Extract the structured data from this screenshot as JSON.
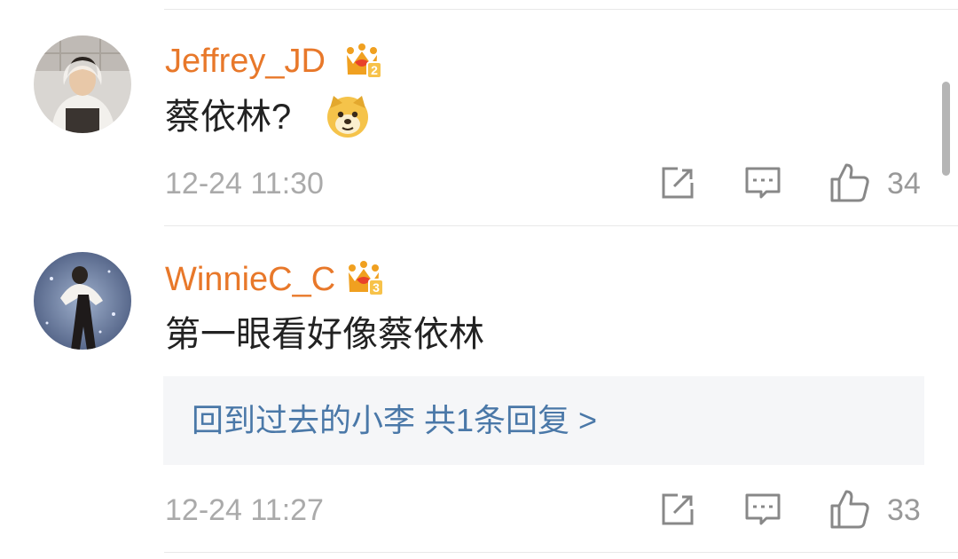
{
  "comments": [
    {
      "username": "Jeffrey_JD",
      "badge_level": "2",
      "text": "蔡依林?",
      "emoji": "doge-emoji",
      "timestamp": "12-24 11:30",
      "likes": "34"
    },
    {
      "username": "WinnieC_C",
      "badge_level": "3",
      "text": "第一眼看好像蔡依林",
      "reply_summary": "回到过去的小李  共1条回复 >",
      "timestamp": "12-24 11:27",
      "likes": "33"
    }
  ],
  "icons": {
    "repost": "repost-icon",
    "comment": "comment-icon",
    "like": "thumbs-up-icon",
    "badge": "crown-badge-icon"
  },
  "colors": {
    "username": "#e8782a",
    "reply_link": "#4a78a8",
    "meta_text": "#aaaaaa",
    "badge": "#f0a020",
    "reply_bg": "#f5f6f8"
  }
}
